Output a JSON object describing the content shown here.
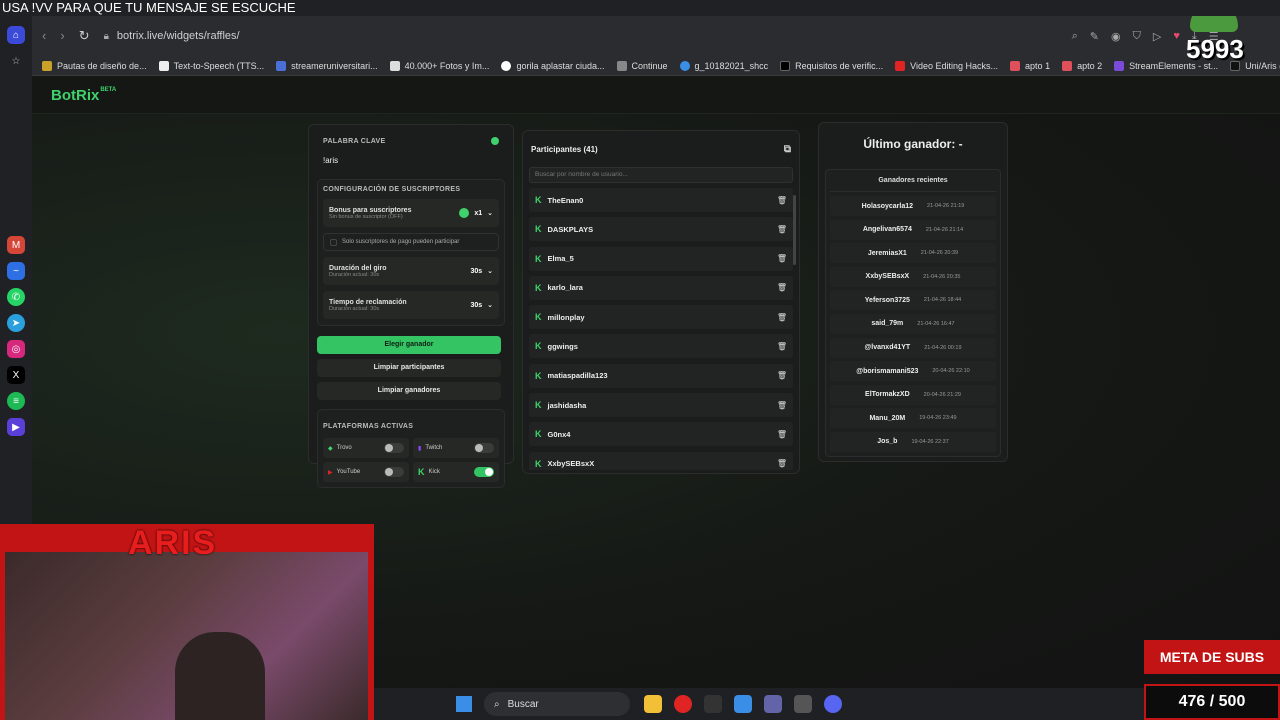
{
  "stream": {
    "banner": "USA !VV PARA QUE TU MENSAJE SE ESCUCHE",
    "sub_count": "5993",
    "streamer_name": "ARIS",
    "meta_label": "META DE SUBS",
    "meta_progress": "476 / 500"
  },
  "browser": {
    "url": "botrix.live/widgets/raffles/",
    "bookmarks": [
      "Pautas de diseño de...",
      "Text-to-Speech (TTS...",
      "streameruniversitari...",
      "40.000+ Fotos y Im...",
      "gorila aplastar ciuda...",
      "Continue",
      "g_10182021_shcc",
      "Requisitos de verific...",
      "Video Editing Hacks...",
      "apto 1",
      "apto 2",
      "StreamElements - st...",
      "Uni/Aris (@streame..."
    ]
  },
  "app": {
    "logo": "BotRix",
    "logo_badge": "BETA"
  },
  "left": {
    "keyword_label": "PALABRA CLAVE",
    "keyword_value": "!aris",
    "sub_config_label": "CONFIGURACIÓN DE SUSCRIPTORES",
    "bonus_title": "Bonus para suscriptores",
    "bonus_sub": "Sin bonus de suscriptor (OFF)",
    "bonus_value": "x1",
    "paid_only": "Solo suscriptores de pago pueden participar",
    "spin_title": "Duración del giro",
    "spin_sub": "Duración actual: 30s",
    "spin_value": "30s",
    "claim_title": "Tiempo de reclamación",
    "claim_sub": "Duración actual: 30s",
    "claim_value": "30s",
    "pick_winner": "Elegir ganador",
    "clear_participants": "Limpiar participantes",
    "clear_winners": "Limpiar ganadores",
    "platforms_label": "PLATAFORMAS ACTIVAS",
    "platforms": [
      {
        "name": "Trovo",
        "on": false
      },
      {
        "name": "Twitch",
        "on": false
      },
      {
        "name": "YouTube",
        "on": false
      },
      {
        "name": "Kick",
        "on": true
      }
    ]
  },
  "participants": {
    "title": "Participantes (41)",
    "search_placeholder": "Buscar por nombre de usuario...",
    "items": [
      "TheEnan0",
      "DASKPLAYS",
      "Elma_5",
      "karlo_lara",
      "millonplay",
      "ggwings",
      "matiaspadilla123",
      "jashidasha",
      "G0nx4",
      "XxbySEBsxX"
    ]
  },
  "winners": {
    "last_winner": "Último ganador: -",
    "recent_label": "Ganadores recientes",
    "items": [
      {
        "name": "Holasoycarla12",
        "date": "21-04-26 21:19"
      },
      {
        "name": "Angelivan6574",
        "date": "21-04-26 21:14"
      },
      {
        "name": "JeremiasX1",
        "date": "21-04-26 20:39"
      },
      {
        "name": "XxbySEBsxX",
        "date": "21-04-26 20:35"
      },
      {
        "name": "Yeferson3725",
        "date": "21-04-26 18:44"
      },
      {
        "name": "said_79m",
        "date": "21-04-26 16:47"
      },
      {
        "name": "@lvanxd41YT",
        "date": "21-04-26 00:19"
      },
      {
        "name": "@borismamani523",
        "date": "20-04-26 22:10"
      },
      {
        "name": "ElTormakzXD",
        "date": "20-04-26 21:29"
      },
      {
        "name": "Manu_20M",
        "date": "19-04-26 23:49"
      },
      {
        "name": "Jos_b",
        "date": "19-04-26 22:37"
      }
    ]
  },
  "taskbar": {
    "search_label": "Buscar"
  }
}
